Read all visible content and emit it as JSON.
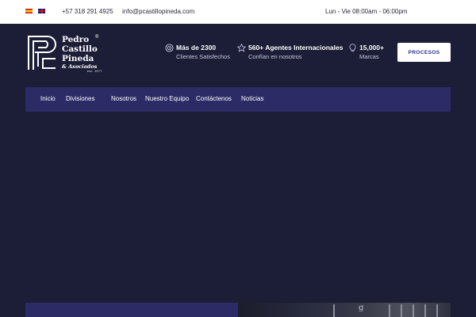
{
  "topbar": {
    "languages": [
      "es",
      "en"
    ],
    "phone": "+57 318 291 4925",
    "email": "info@pcastillopineda.com",
    "hours": "Lun - Vie 08:00am - 06:00pm"
  },
  "logo": {
    "line1": "Pedro",
    "line2": "Castillo",
    "line3": "Pineda",
    "line4": "& Asociados",
    "est": "est. 1977",
    "reg": "®"
  },
  "stats": [
    {
      "icon": "target-icon",
      "title": "Más de 2300",
      "subtitle": "Clientes Satisfechos"
    },
    {
      "icon": "star-icon",
      "title": "560+ Agentes Internacionales",
      "subtitle": "Confían en nosotros"
    },
    {
      "icon": "lightbulb-icon",
      "title": "15,000+",
      "subtitle": "Marcas"
    }
  ],
  "header": {
    "cta_label": "PROCESOS"
  },
  "nav": {
    "items": [
      "Inicio",
      "Divisiones",
      "Nosotros",
      "Nuestro Equipo",
      "Contáctenos",
      "Noticias"
    ]
  },
  "bottom_card": {
    "mark": "g"
  },
  "colors": {
    "background": "#1c1d36",
    "nav": "#2c2b66",
    "accent_text": "#2c2f8c"
  }
}
